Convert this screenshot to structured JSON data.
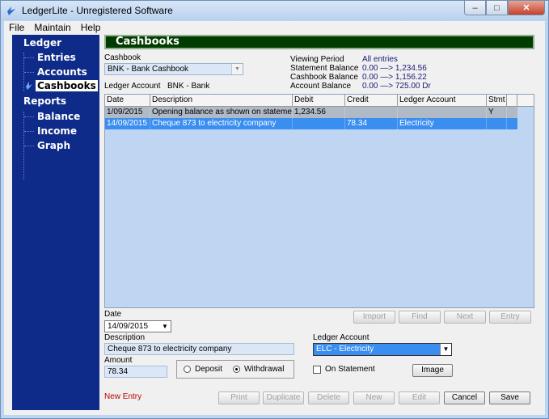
{
  "window": {
    "title": "LedgerLite - Unregistered Software",
    "minimize": "–",
    "maximize": "□",
    "close": "✕"
  },
  "menu": {
    "file": "File",
    "maintain": "Maintain",
    "help": "Help"
  },
  "sidebar": {
    "ledger": "Ledger",
    "entries": "Entries",
    "accounts": "Accounts",
    "cashbooks": "Cashbooks",
    "reports": "Reports",
    "balance": "Balance",
    "income": "Income",
    "graph": "Graph",
    "selected": "Cashbooks"
  },
  "header": {
    "title": "Cashbooks"
  },
  "cashbook": {
    "label": "Cashbook",
    "selected": "BNK - Bank Cashbook",
    "ledger_account_label": "Ledger Account",
    "ledger_account_value": "BNK - Bank"
  },
  "summary": {
    "viewing_period_label": "Viewing Period",
    "viewing_period_value": "All entries",
    "statement_balance_label": "Statement Balance",
    "statement_balance_value": "0.00 —> 1,234.56",
    "cashbook_balance_label": "Cashbook Balance",
    "cashbook_balance_value": "0.00 —> 1,156.22",
    "account_balance_label": "Account Balance",
    "account_balance_value": "0.00 —> 725.00  Dr"
  },
  "grid": {
    "columns": [
      "Date",
      "Description",
      "Debit",
      "Credit",
      "Ledger Account",
      "Stmt"
    ],
    "rows": [
      {
        "date": "1/09/2015",
        "description": "Opening balance as shown on statement",
        "debit": "1,234.56",
        "credit": "",
        "ledger_account": "",
        "stmt": "Y"
      },
      {
        "date": "14/09/2015",
        "description": "Cheque 873 to electricity company",
        "debit": "",
        "credit": "78.34",
        "ledger_account": "Electricity",
        "stmt": ""
      }
    ]
  },
  "grid_buttons": {
    "import": "Import",
    "find": "Find",
    "next": "Next",
    "entry": "Entry"
  },
  "form": {
    "date_label": "Date",
    "date_value": "14/09/2015",
    "description_label": "Description",
    "description_value": "Cheque 873 to electricity company",
    "amount_label": "Amount",
    "amount_value": "78.34",
    "deposit_label": "Deposit",
    "withdrawal_label": "Withdrawal",
    "type_selected": "Withdrawal",
    "ledger_account_label": "Ledger Account",
    "ledger_account_value": "ELC - Electricity",
    "on_statement_label": "On Statement",
    "on_statement_checked": false,
    "image_button": "Image"
  },
  "status": {
    "text": "New Entry",
    "color": "#c00000"
  },
  "bottom_buttons": {
    "print": "Print",
    "duplicate": "Duplicate",
    "delete": "Delete",
    "new": "New",
    "edit": "Edit",
    "cancel": "Cancel",
    "save": "Save"
  },
  "colors": {
    "sidebar": "#0f2b8a",
    "header": "#003c00",
    "selection": "#3a8ef0"
  }
}
